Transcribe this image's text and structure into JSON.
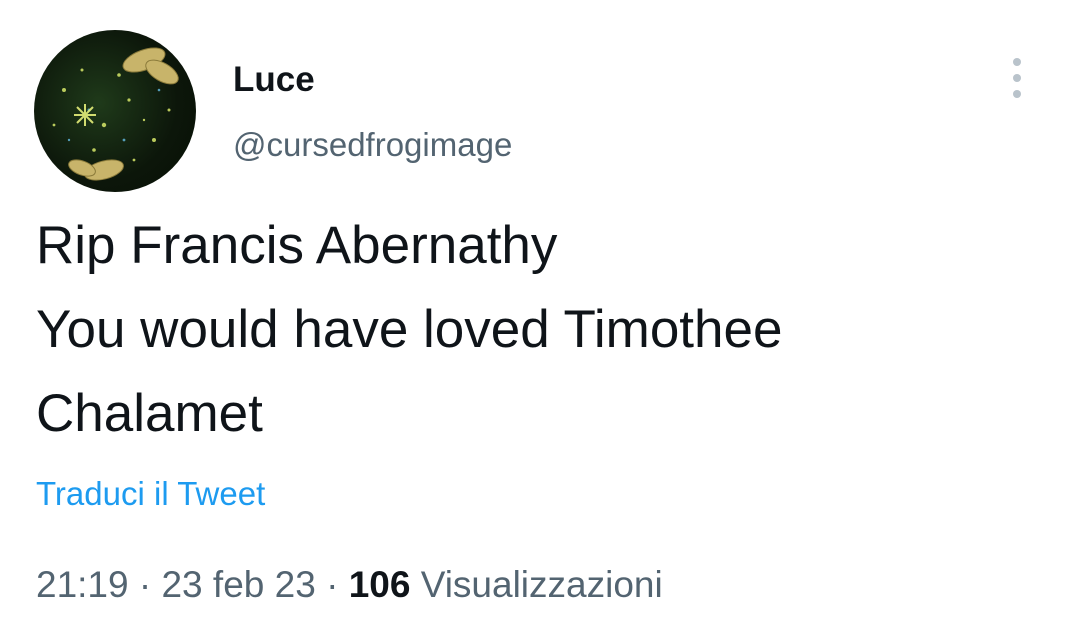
{
  "author": {
    "display_name": "Luce",
    "handle": "@cursedfrogimage",
    "avatar_icon": "avatar-image"
  },
  "more_icon": "more-options-icon",
  "tweet": {
    "lines": [
      "Rip Francis Abernathy",
      "You would have loved Timothee",
      "Chalamet"
    ],
    "translate_label": "Traduci il Tweet"
  },
  "meta": {
    "time": "21:19",
    "separator1": " · ",
    "date": "23 feb 23",
    "separator2": " · ",
    "views_count": "106",
    "views_label": " Visualizzazioni"
  },
  "colors": {
    "text_primary": "#0f1419",
    "text_secondary": "#536471",
    "link": "#1d9bf0"
  }
}
